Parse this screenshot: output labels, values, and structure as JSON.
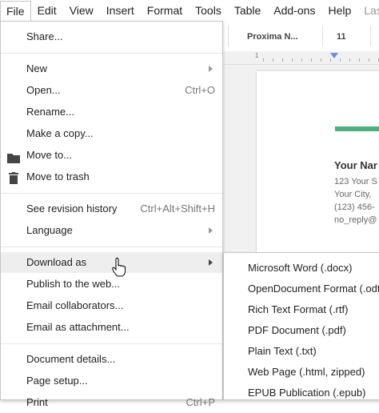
{
  "menubar": {
    "items": [
      {
        "label": "File"
      },
      {
        "label": "Edit"
      },
      {
        "label": "View"
      },
      {
        "label": "Insert"
      },
      {
        "label": "Format"
      },
      {
        "label": "Tools"
      },
      {
        "label": "Table"
      },
      {
        "label": "Add-ons"
      },
      {
        "label": "Help"
      },
      {
        "label": "Last e"
      }
    ]
  },
  "toolbar": {
    "font": "Proxima N...",
    "size": "11"
  },
  "ruler": {
    "mark": "1"
  },
  "document": {
    "name": "Your Nar",
    "lines": [
      "123 Your S",
      "Your City,",
      "(123) 456-",
      "no_reply@"
    ],
    "accent_color": "#4caf7c"
  },
  "file_menu": {
    "share": "Share...",
    "new": "New",
    "open": "Open...",
    "open_shortcut": "Ctrl+O",
    "rename": "Rename...",
    "make_copy": "Make a copy...",
    "move_to": "Move to...",
    "move_to_trash": "Move to trash",
    "revision_history": "See revision history",
    "revision_shortcut": "Ctrl+Alt+Shift+H",
    "language": "Language",
    "download_as": "Download as",
    "publish": "Publish to the web...",
    "email_collaborators": "Email collaborators...",
    "email_attachment": "Email as attachment...",
    "document_details": "Document details...",
    "page_setup": "Page setup...",
    "print": "Print",
    "print_shortcut": "Ctrl+P"
  },
  "download_submenu": {
    "items": [
      "Microsoft Word (.docx)",
      "OpenDocument Format (.odt)",
      "Rich Text Format (.rtf)",
      "PDF Document (.pdf)",
      "Plain Text (.txt)",
      "Web Page (.html, zipped)",
      "EPUB Publication (.epub)"
    ]
  },
  "icons": {
    "folder": "folder-icon",
    "trash": "trash-icon",
    "cursor": "hand-cursor-icon"
  }
}
